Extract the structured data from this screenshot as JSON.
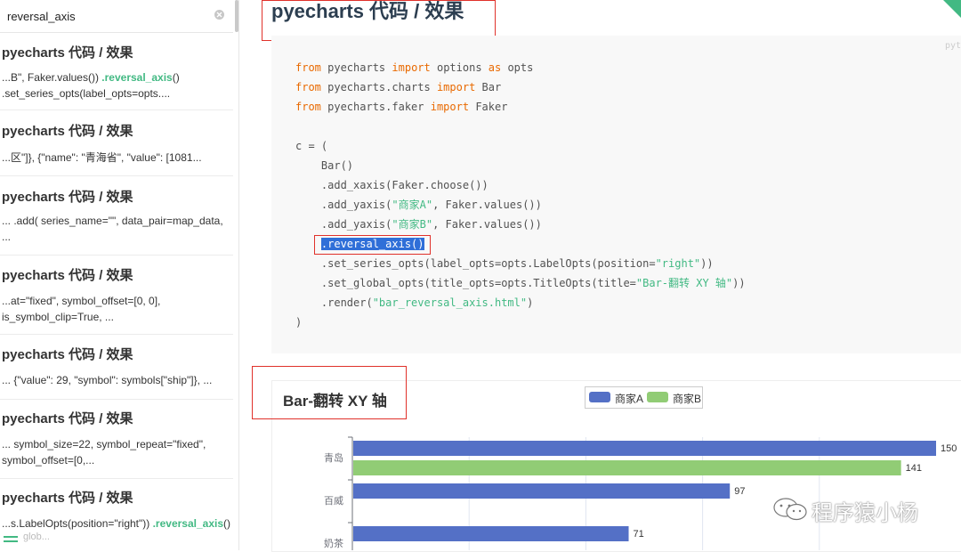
{
  "search": {
    "value": "reversal_axis"
  },
  "sidebar": {
    "results": [
      {
        "title": "pyecharts 代码 / 效果",
        "pre": "...B\", Faker.values()) ",
        "hl": ".reversal_axis",
        "post": "()\n.set_series_opts(label_opts=opts...."
      },
      {
        "title": "pyecharts 代码 / 效果",
        "pre": "...区\"]}, {\"name\": \"青海省\", \"value\": [1081...",
        "hl": "",
        "post": ""
      },
      {
        "title": "pyecharts 代码 / 效果",
        "pre": "... .add( series_name=\"\", data_pair=map_data,\n...",
        "hl": "",
        "post": ""
      },
      {
        "title": "pyecharts 代码 / 效果",
        "pre": "...at=\"fixed\", symbol_offset=[0, 0],\nis_symbol_clip=True, ...",
        "hl": "",
        "post": ""
      },
      {
        "title": "pyecharts 代码 / 效果",
        "pre": "... {\"value\": 29, \"symbol\": symbols[\"ship\"]}, ...",
        "hl": "",
        "post": ""
      },
      {
        "title": "pyecharts 代码 / 效果",
        "pre": "... symbol_size=22, symbol_repeat=\"fixed\",\nsymbol_offset=[0,...",
        "hl": "",
        "post": ""
      },
      {
        "title": "pyecharts 代码 / 效果",
        "pre": "...s.LabelOpts(position=\"right\")) ",
        "hl": ".reversal_axis",
        "post": "()"
      }
    ],
    "faded_snippet": "glob..."
  },
  "main": {
    "page_title": "pyecharts 代码 / 效果",
    "code_lang": "pyt",
    "code": {
      "l1": {
        "kw1": "from",
        "a": " pyecharts ",
        "kw2": "import",
        "b": " options ",
        "kw3": "as",
        "c": " opts"
      },
      "l2": {
        "kw1": "from",
        "a": " pyecharts.charts ",
        "kw2": "import",
        "b": " Bar"
      },
      "l3": {
        "kw1": "from",
        "a": " pyecharts.faker ",
        "kw2": "import",
        "b": " Faker"
      },
      "l4": "c = (",
      "l5": "    Bar()",
      "l6": "    .add_xaxis(Faker.choose())",
      "l7": {
        "a": "    .add_yaxis(",
        "s": "\"商家A\"",
        "b": ", Faker.values())"
      },
      "l8": {
        "a": "    .add_yaxis(",
        "s": "\"商家B\"",
        "b": ", Faker.values())"
      },
      "l9": {
        "a": "    ",
        "sel": ".reversal_axis()"
      },
      "l10": {
        "a": "    .set_series_opts(label_opts=opts.LabelOpts(position=",
        "s": "\"right\"",
        "b": "))"
      },
      "l11": {
        "a": "    .set_global_opts(title_opts=opts.TitleOpts(title=",
        "s": "\"Bar-翻转 XY 轴\"",
        "b": "))"
      },
      "l12": {
        "a": "    .render(",
        "s": "\"bar_reversal_axis.html\"",
        "b": ")"
      },
      "l13": ")"
    }
  },
  "watermark": "程序猿小杨",
  "chart_data": {
    "type": "bar",
    "orientation": "horizontal",
    "title": "Bar-翻转 XY 轴",
    "categories": [
      "青岛",
      "百威",
      "奶茶"
    ],
    "series": [
      {
        "name": "商家A",
        "color": "#5470c6",
        "values": [
          150,
          97,
          71
        ]
      },
      {
        "name": "商家B",
        "color": "#91cc75",
        "values": [
          141,
          null,
          null
        ]
      }
    ],
    "xlim": [
      0,
      150
    ],
    "label_position": "right",
    "legend": "top-center"
  }
}
